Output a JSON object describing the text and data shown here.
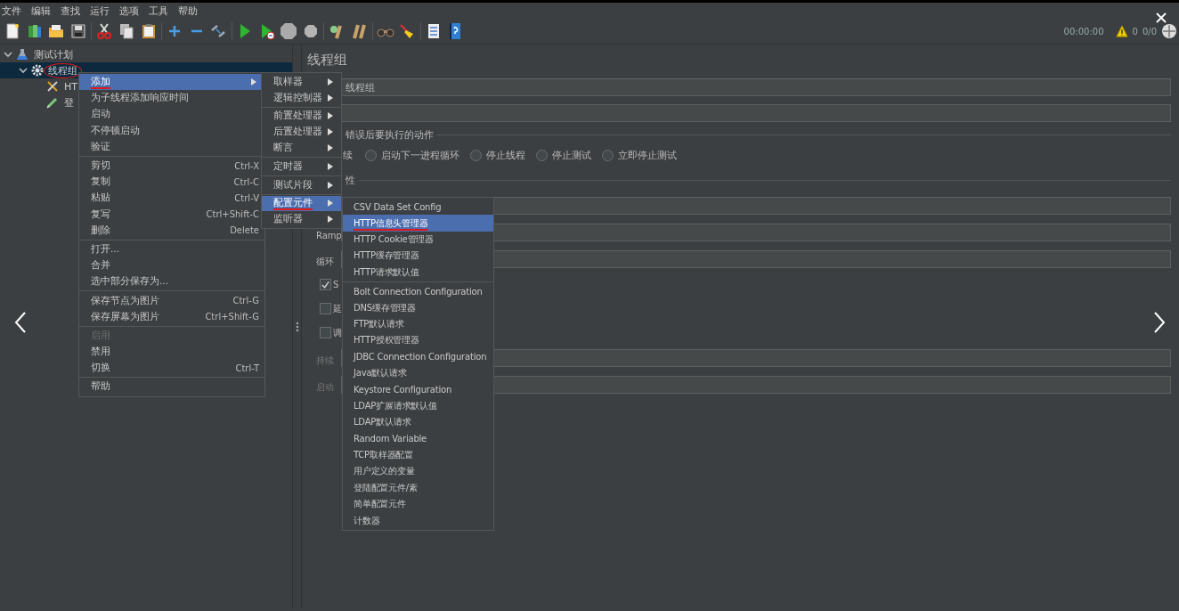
{
  "menu_bar": [
    "文件",
    "编辑",
    "查找",
    "运行",
    "选项",
    "工具",
    "帮助"
  ],
  "status": {
    "elapsed": "00:00:00",
    "warnings": "0",
    "threads": "0/0"
  },
  "tree": [
    {
      "label": "测试计划",
      "kind": "plan",
      "expanded": true,
      "selected": false,
      "circled": false,
      "children": [
        {
          "label": "线程组",
          "kind": "thread_group",
          "expanded": true,
          "selected": true,
          "circled": true,
          "children": [
            {
              "label": "HT",
              "kind": "sampler",
              "selected": false,
              "circled": false
            },
            {
              "label": "登",
              "kind": "config",
              "selected": false,
              "circled": false
            }
          ]
        }
      ]
    }
  ],
  "form": {
    "title": "线程组",
    "rows": [
      {
        "kind": "field",
        "value": "线程组"
      },
      {
        "kind": "field"
      },
      {
        "kind": "legend",
        "label": "错误后要执行的动作"
      },
      {
        "kind": "radios",
        "lead": "续",
        "options": [
          {
            "label": "启动下一进程循环",
            "selected": false
          },
          {
            "label": "停止线程",
            "selected": false
          },
          {
            "label": "停止测试",
            "selected": false
          },
          {
            "label": "立即停止测试",
            "selected": false
          }
        ]
      },
      {
        "kind": "heading",
        "label": "性"
      },
      {
        "kind": "field"
      },
      {
        "kind": "field",
        "label": "Ramp"
      },
      {
        "kind": "field",
        "label": "循环"
      },
      {
        "kind": "checkbox",
        "label": "S",
        "checked": true
      },
      {
        "kind": "checkbox",
        "label": "延",
        "checked": false
      },
      {
        "kind": "checkbox",
        "label": "调",
        "checked": false
      },
      {
        "kind": "field",
        "label": "持续",
        "disabled": true
      },
      {
        "kind": "field",
        "label": "启动",
        "disabled": true
      }
    ]
  },
  "context_menu": {
    "sections": [
      {
        "items": [
          {
            "label": "添加",
            "submenu": true,
            "selected": true,
            "disabled": false,
            "underlined": true
          },
          {
            "label": "为子线程添加响应时间",
            "submenu": false,
            "selected": false,
            "disabled": false,
            "underlined": false
          },
          {
            "label": "启动",
            "submenu": false,
            "selected": false,
            "disabled": false,
            "underlined": false
          },
          {
            "label": "不停顿启动",
            "submenu": false,
            "selected": false,
            "disabled": false,
            "underlined": false
          },
          {
            "label": "验证",
            "submenu": false,
            "selected": false,
            "disabled": false,
            "underlined": false
          }
        ]
      },
      {
        "items": [
          {
            "label": "剪切",
            "shortcut": "Ctrl-X",
            "submenu": false,
            "selected": false,
            "disabled": false,
            "underlined": false
          },
          {
            "label": "复制",
            "shortcut": "Ctrl-C",
            "submenu": false,
            "selected": false,
            "disabled": false,
            "underlined": false
          },
          {
            "label": "粘贴",
            "shortcut": "Ctrl-V",
            "submenu": false,
            "selected": false,
            "disabled": false,
            "underlined": false
          },
          {
            "label": "复写",
            "shortcut": "Ctrl+Shift-C",
            "submenu": false,
            "selected": false,
            "disabled": false,
            "underlined": false
          },
          {
            "label": "删除",
            "shortcut": "Delete",
            "submenu": false,
            "selected": false,
            "disabled": false,
            "underlined": false
          }
        ]
      },
      {
        "items": [
          {
            "label": "打开...",
            "submenu": false,
            "selected": false,
            "disabled": false,
            "underlined": false
          },
          {
            "label": "合并",
            "submenu": false,
            "selected": false,
            "disabled": false,
            "underlined": false
          },
          {
            "label": "选中部分保存为...",
            "submenu": false,
            "selected": false,
            "disabled": false,
            "underlined": false
          }
        ]
      },
      {
        "items": [
          {
            "label": "保存节点为图片",
            "shortcut": "Ctrl-G",
            "submenu": false,
            "selected": false,
            "disabled": false,
            "underlined": false
          },
          {
            "label": "保存屏幕为图片",
            "shortcut": "Ctrl+Shift-G",
            "submenu": false,
            "selected": false,
            "disabled": false,
            "underlined": false
          }
        ]
      },
      {
        "items": [
          {
            "label": "启用",
            "submenu": false,
            "selected": false,
            "disabled": true,
            "underlined": false
          },
          {
            "label": "禁用",
            "submenu": false,
            "selected": false,
            "disabled": false,
            "underlined": false
          },
          {
            "label": "切换",
            "shortcut": "Ctrl-T",
            "submenu": false,
            "selected": false,
            "disabled": false,
            "underlined": false
          }
        ]
      },
      {
        "items": [
          {
            "label": "帮助",
            "submenu": false,
            "selected": false,
            "disabled": false,
            "underlined": false
          }
        ]
      }
    ]
  },
  "add_submenu": {
    "sections": [
      {
        "items": [
          {
            "label": "取样器",
            "submenu": true,
            "selected": false,
            "underlined": false
          },
          {
            "label": "逻辑控制器",
            "submenu": true,
            "selected": false,
            "underlined": false
          }
        ]
      },
      {
        "items": [
          {
            "label": "前置处理器",
            "submenu": true,
            "selected": false,
            "underlined": false
          },
          {
            "label": "后置处理器",
            "submenu": true,
            "selected": false,
            "underlined": false
          },
          {
            "label": "断言",
            "submenu": true,
            "selected": false,
            "underlined": false
          }
        ]
      },
      {
        "items": [
          {
            "label": "定时器",
            "submenu": true,
            "selected": false,
            "underlined": false
          }
        ]
      },
      {
        "items": [
          {
            "label": "测试片段",
            "submenu": true,
            "selected": false,
            "underlined": false
          }
        ]
      },
      {
        "items": [
          {
            "label": "配置元件",
            "submenu": true,
            "selected": true,
            "underlined": true
          },
          {
            "label": "监听器",
            "submenu": true,
            "selected": false,
            "underlined": false
          }
        ]
      }
    ]
  },
  "config_submenu": {
    "sections": [
      {
        "items": [
          {
            "label": "CSV Data Set Config",
            "selected": false,
            "underlined": false
          },
          {
            "label": "HTTP信息头管理器",
            "selected": true,
            "underlined": true
          },
          {
            "label": "HTTP Cookie管理器",
            "selected": false,
            "underlined": false
          },
          {
            "label": "HTTP缓存管理器",
            "selected": false,
            "underlined": false
          },
          {
            "label": "HTTP请求默认值",
            "selected": false,
            "underlined": false
          }
        ]
      },
      {
        "items": [
          {
            "label": "Bolt Connection Configuration",
            "selected": false,
            "underlined": false
          },
          {
            "label": "DNS缓存管理器",
            "selected": false,
            "underlined": false
          },
          {
            "label": "FTP默认请求",
            "selected": false,
            "underlined": false
          },
          {
            "label": "HTTP授权管理器",
            "selected": false,
            "underlined": false
          },
          {
            "label": "JDBC Connection Configuration",
            "selected": false,
            "underlined": false
          },
          {
            "label": "Java默认请求",
            "selected": false,
            "underlined": false
          },
          {
            "label": "Keystore Configuration",
            "selected": false,
            "underlined": false
          },
          {
            "label": "LDAP扩展请求默认值",
            "selected": false,
            "underlined": false
          },
          {
            "label": "LDAP默认请求",
            "selected": false,
            "underlined": false
          },
          {
            "label": "Random Variable",
            "selected": false,
            "underlined": false
          },
          {
            "label": "TCP取样器配置",
            "selected": false,
            "underlined": false
          },
          {
            "label": "用户定义的变量",
            "selected": false,
            "underlined": false
          },
          {
            "label": "登陆配置元件/素",
            "selected": false,
            "underlined": false
          },
          {
            "label": "简单配置元件",
            "selected": false,
            "underlined": false
          },
          {
            "label": "计数器",
            "selected": false,
            "underlined": false
          }
        ]
      }
    ]
  }
}
